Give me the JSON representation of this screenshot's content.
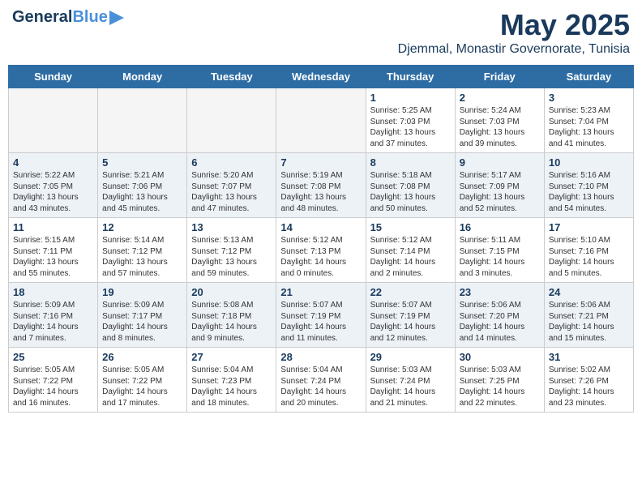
{
  "header": {
    "logo_general": "General",
    "logo_blue": "Blue",
    "month_title": "May 2025",
    "location": "Djemmal, Monastir Governorate, Tunisia"
  },
  "days_of_week": [
    "Sunday",
    "Monday",
    "Tuesday",
    "Wednesday",
    "Thursday",
    "Friday",
    "Saturday"
  ],
  "weeks": [
    [
      {
        "day": "",
        "sunrise": "",
        "sunset": "",
        "daylight": "",
        "empty": true
      },
      {
        "day": "",
        "sunrise": "",
        "sunset": "",
        "daylight": "",
        "empty": true
      },
      {
        "day": "",
        "sunrise": "",
        "sunset": "",
        "daylight": "",
        "empty": true
      },
      {
        "day": "",
        "sunrise": "",
        "sunset": "",
        "daylight": "",
        "empty": true
      },
      {
        "day": "1",
        "sunrise": "Sunrise: 5:25 AM",
        "sunset": "Sunset: 7:03 PM",
        "daylight": "Daylight: 13 hours and 37 minutes.",
        "empty": false
      },
      {
        "day": "2",
        "sunrise": "Sunrise: 5:24 AM",
        "sunset": "Sunset: 7:03 PM",
        "daylight": "Daylight: 13 hours and 39 minutes.",
        "empty": false
      },
      {
        "day": "3",
        "sunrise": "Sunrise: 5:23 AM",
        "sunset": "Sunset: 7:04 PM",
        "daylight": "Daylight: 13 hours and 41 minutes.",
        "empty": false
      }
    ],
    [
      {
        "day": "4",
        "sunrise": "Sunrise: 5:22 AM",
        "sunset": "Sunset: 7:05 PM",
        "daylight": "Daylight: 13 hours and 43 minutes.",
        "empty": false
      },
      {
        "day": "5",
        "sunrise": "Sunrise: 5:21 AM",
        "sunset": "Sunset: 7:06 PM",
        "daylight": "Daylight: 13 hours and 45 minutes.",
        "empty": false
      },
      {
        "day": "6",
        "sunrise": "Sunrise: 5:20 AM",
        "sunset": "Sunset: 7:07 PM",
        "daylight": "Daylight: 13 hours and 47 minutes.",
        "empty": false
      },
      {
        "day": "7",
        "sunrise": "Sunrise: 5:19 AM",
        "sunset": "Sunset: 7:08 PM",
        "daylight": "Daylight: 13 hours and 48 minutes.",
        "empty": false
      },
      {
        "day": "8",
        "sunrise": "Sunrise: 5:18 AM",
        "sunset": "Sunset: 7:08 PM",
        "daylight": "Daylight: 13 hours and 50 minutes.",
        "empty": false
      },
      {
        "day": "9",
        "sunrise": "Sunrise: 5:17 AM",
        "sunset": "Sunset: 7:09 PM",
        "daylight": "Daylight: 13 hours and 52 minutes.",
        "empty": false
      },
      {
        "day": "10",
        "sunrise": "Sunrise: 5:16 AM",
        "sunset": "Sunset: 7:10 PM",
        "daylight": "Daylight: 13 hours and 54 minutes.",
        "empty": false
      }
    ],
    [
      {
        "day": "11",
        "sunrise": "Sunrise: 5:15 AM",
        "sunset": "Sunset: 7:11 PM",
        "daylight": "Daylight: 13 hours and 55 minutes.",
        "empty": false
      },
      {
        "day": "12",
        "sunrise": "Sunrise: 5:14 AM",
        "sunset": "Sunset: 7:12 PM",
        "daylight": "Daylight: 13 hours and 57 minutes.",
        "empty": false
      },
      {
        "day": "13",
        "sunrise": "Sunrise: 5:13 AM",
        "sunset": "Sunset: 7:12 PM",
        "daylight": "Daylight: 13 hours and 59 minutes.",
        "empty": false
      },
      {
        "day": "14",
        "sunrise": "Sunrise: 5:12 AM",
        "sunset": "Sunset: 7:13 PM",
        "daylight": "Daylight: 14 hours and 0 minutes.",
        "empty": false
      },
      {
        "day": "15",
        "sunrise": "Sunrise: 5:12 AM",
        "sunset": "Sunset: 7:14 PM",
        "daylight": "Daylight: 14 hours and 2 minutes.",
        "empty": false
      },
      {
        "day": "16",
        "sunrise": "Sunrise: 5:11 AM",
        "sunset": "Sunset: 7:15 PM",
        "daylight": "Daylight: 14 hours and 3 minutes.",
        "empty": false
      },
      {
        "day": "17",
        "sunrise": "Sunrise: 5:10 AM",
        "sunset": "Sunset: 7:16 PM",
        "daylight": "Daylight: 14 hours and 5 minutes.",
        "empty": false
      }
    ],
    [
      {
        "day": "18",
        "sunrise": "Sunrise: 5:09 AM",
        "sunset": "Sunset: 7:16 PM",
        "daylight": "Daylight: 14 hours and 7 minutes.",
        "empty": false
      },
      {
        "day": "19",
        "sunrise": "Sunrise: 5:09 AM",
        "sunset": "Sunset: 7:17 PM",
        "daylight": "Daylight: 14 hours and 8 minutes.",
        "empty": false
      },
      {
        "day": "20",
        "sunrise": "Sunrise: 5:08 AM",
        "sunset": "Sunset: 7:18 PM",
        "daylight": "Daylight: 14 hours and 9 minutes.",
        "empty": false
      },
      {
        "day": "21",
        "sunrise": "Sunrise: 5:07 AM",
        "sunset": "Sunset: 7:19 PM",
        "daylight": "Daylight: 14 hours and 11 minutes.",
        "empty": false
      },
      {
        "day": "22",
        "sunrise": "Sunrise: 5:07 AM",
        "sunset": "Sunset: 7:19 PM",
        "daylight": "Daylight: 14 hours and 12 minutes.",
        "empty": false
      },
      {
        "day": "23",
        "sunrise": "Sunrise: 5:06 AM",
        "sunset": "Sunset: 7:20 PM",
        "daylight": "Daylight: 14 hours and 14 minutes.",
        "empty": false
      },
      {
        "day": "24",
        "sunrise": "Sunrise: 5:06 AM",
        "sunset": "Sunset: 7:21 PM",
        "daylight": "Daylight: 14 hours and 15 minutes.",
        "empty": false
      }
    ],
    [
      {
        "day": "25",
        "sunrise": "Sunrise: 5:05 AM",
        "sunset": "Sunset: 7:22 PM",
        "daylight": "Daylight: 14 hours and 16 minutes.",
        "empty": false
      },
      {
        "day": "26",
        "sunrise": "Sunrise: 5:05 AM",
        "sunset": "Sunset: 7:22 PM",
        "daylight": "Daylight: 14 hours and 17 minutes.",
        "empty": false
      },
      {
        "day": "27",
        "sunrise": "Sunrise: 5:04 AM",
        "sunset": "Sunset: 7:23 PM",
        "daylight": "Daylight: 14 hours and 18 minutes.",
        "empty": false
      },
      {
        "day": "28",
        "sunrise": "Sunrise: 5:04 AM",
        "sunset": "Sunset: 7:24 PM",
        "daylight": "Daylight: 14 hours and 20 minutes.",
        "empty": false
      },
      {
        "day": "29",
        "sunrise": "Sunrise: 5:03 AM",
        "sunset": "Sunset: 7:24 PM",
        "daylight": "Daylight: 14 hours and 21 minutes.",
        "empty": false
      },
      {
        "day": "30",
        "sunrise": "Sunrise: 5:03 AM",
        "sunset": "Sunset: 7:25 PM",
        "daylight": "Daylight: 14 hours and 22 minutes.",
        "empty": false
      },
      {
        "day": "31",
        "sunrise": "Sunrise: 5:02 AM",
        "sunset": "Sunset: 7:26 PM",
        "daylight": "Daylight: 14 hours and 23 minutes.",
        "empty": false
      }
    ]
  ]
}
